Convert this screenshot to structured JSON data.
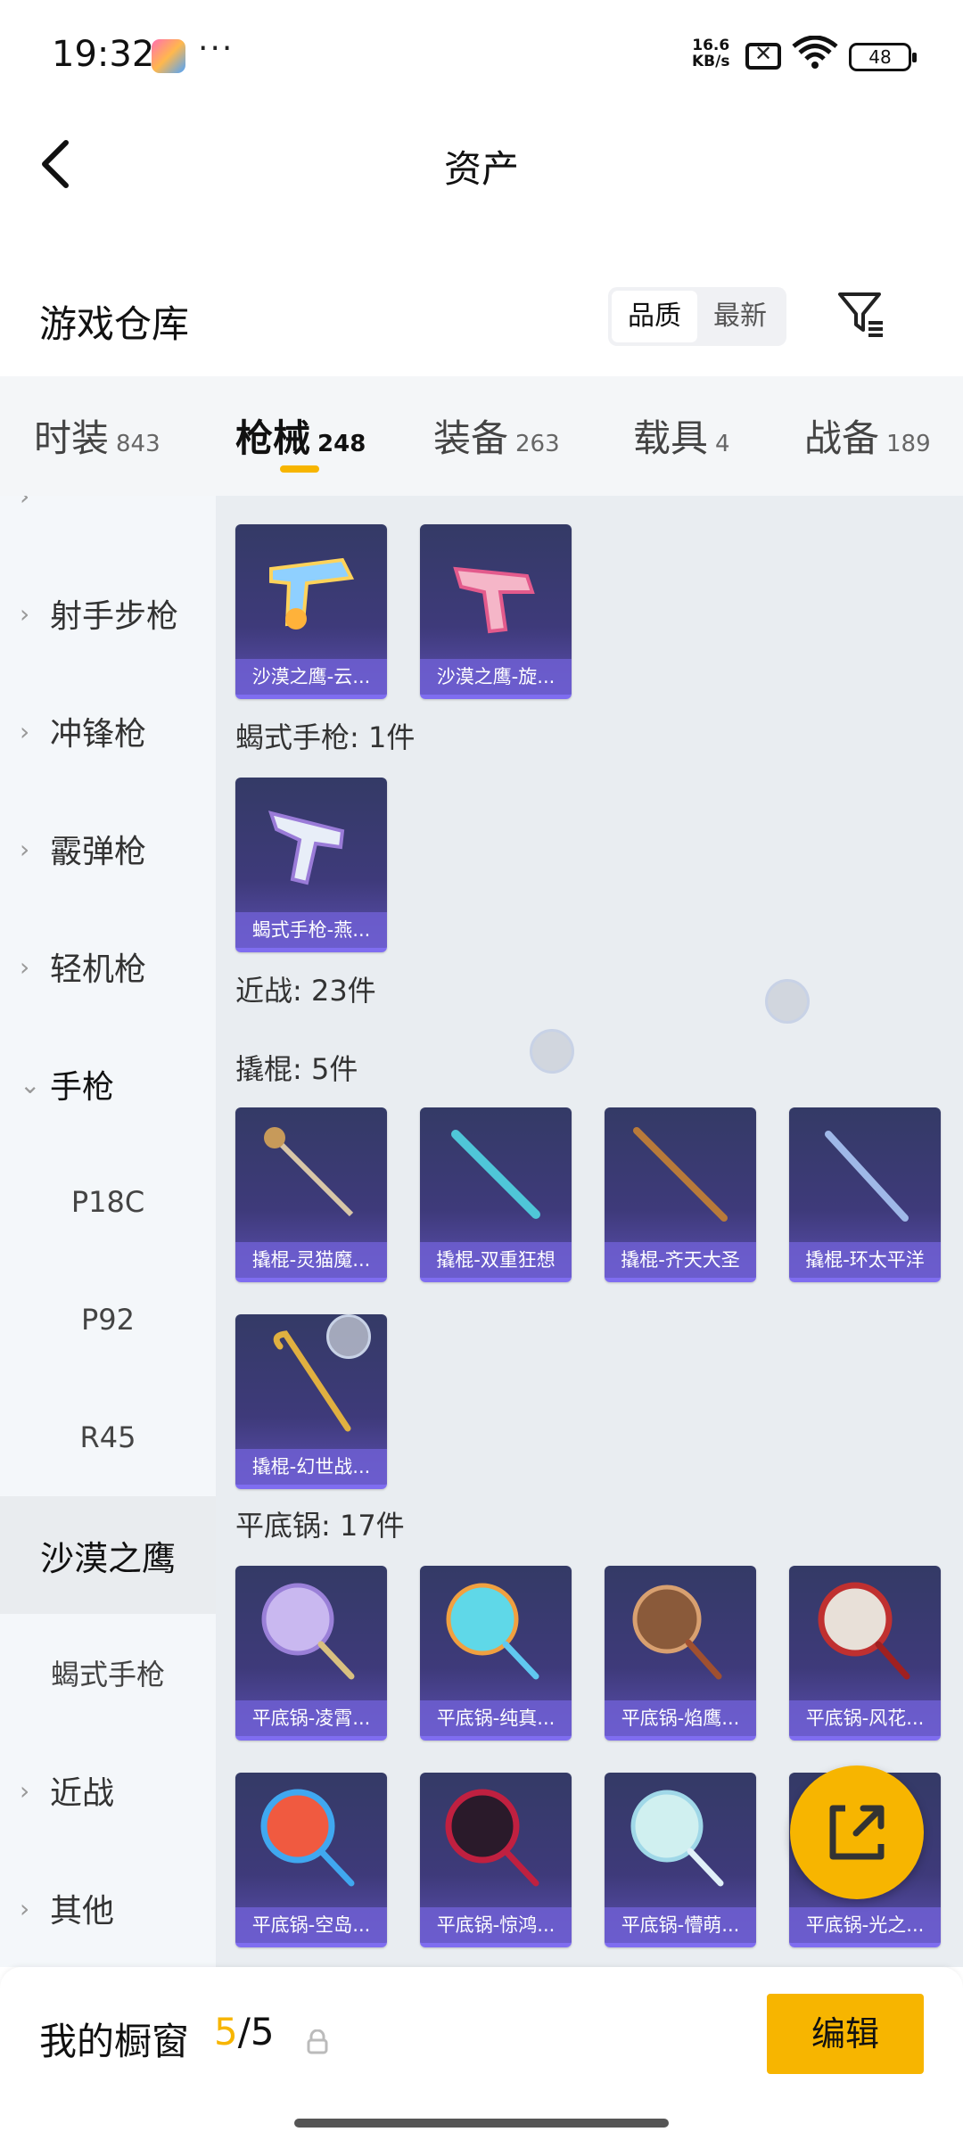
{
  "status_bar": {
    "time": "19:32",
    "dots": "···",
    "net_speed_value": "16.6",
    "net_speed_unit": "KB/s",
    "battery": "48"
  },
  "header": {
    "title": "资产"
  },
  "warehouse": {
    "title": "游戏仓库",
    "sort_options": [
      "品质",
      "最新"
    ],
    "active_sort": "品质"
  },
  "tabs": [
    {
      "label": "时装",
      "count": "843"
    },
    {
      "label": "枪械",
      "count": "248",
      "active": true
    },
    {
      "label": "装备",
      "count": "263"
    },
    {
      "label": "载具",
      "count": "4"
    },
    {
      "label": "战备",
      "count": "189"
    }
  ],
  "sidebar": {
    "items": [
      {
        "label": "射手步枪",
        "chevron": "›"
      },
      {
        "label": "冲锋枪",
        "chevron": "›"
      },
      {
        "label": "霰弹枪",
        "chevron": "›"
      },
      {
        "label": "轻机枪",
        "chevron": "›"
      },
      {
        "label": "手枪",
        "chevron": "⌄"
      },
      {
        "label": "P18C"
      },
      {
        "label": "P92"
      },
      {
        "label": "R45"
      },
      {
        "label": "沙漠之鹰"
      },
      {
        "label": "蝎式手枪"
      },
      {
        "label": "近战",
        "chevron": "›"
      },
      {
        "label": "其他",
        "chevron": "›"
      }
    ]
  },
  "content": {
    "groups": [
      {
        "label": "",
        "cards": [
          "沙漠之鹰-云...",
          "沙漠之鹰-旋..."
        ]
      },
      {
        "label": "蝎式手枪: 1件",
        "cards": [
          "蝎式手枪-燕..."
        ]
      },
      {
        "label": "近战: 23件",
        "cards": []
      },
      {
        "label": "撬棍: 5件",
        "cards": [
          "撬棍-灵猫魔...",
          "撬棍-双重狂想",
          "撬棍-齐天大圣",
          "撬棍-环太平洋",
          "撬棍-幻世战..."
        ]
      },
      {
        "label": "平底锅: 17件",
        "cards": [
          "平底锅-凌霄...",
          "平底锅-纯真...",
          "平底锅-焰鹰...",
          "平底锅-风花...",
          "平底锅-空岛...",
          "平底锅-惊鸿...",
          "平底锅-懵萌...",
          "平底锅-光之..."
        ]
      }
    ]
  },
  "bottom": {
    "window_label": "我的橱窗",
    "window_used": "5",
    "window_total": "/5",
    "edit_label": "编辑"
  },
  "colors": {
    "accent": "#f7b500",
    "card_bg": "#3e3a7a",
    "card_label": "#6e5fd2"
  }
}
